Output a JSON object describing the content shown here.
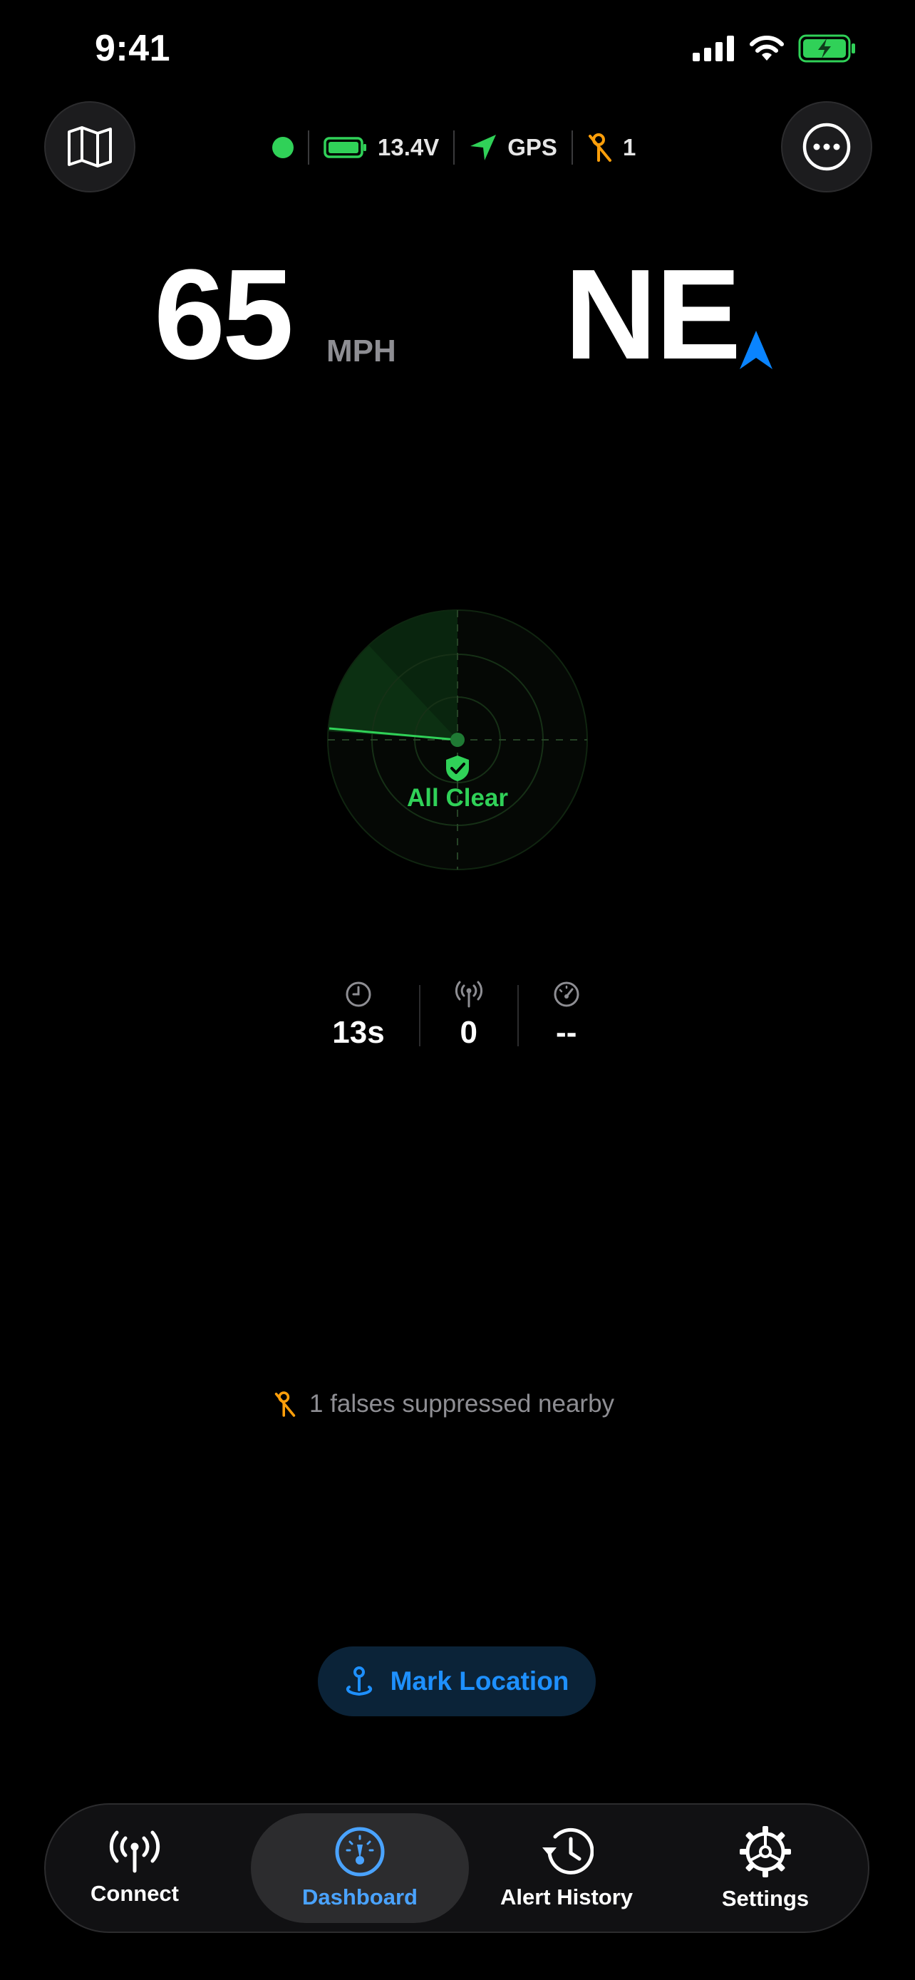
{
  "status_bar": {
    "time": "9:41"
  },
  "header": {
    "voltage": "13.4V",
    "gps_label": "GPS",
    "lockout_count": "1",
    "colors": {
      "connected": "#30d158",
      "lockout": "#ff9f0a"
    }
  },
  "speed": {
    "value": "65",
    "unit": "MPH"
  },
  "heading": {
    "value": "NE",
    "arrow_color": "#0a84ff"
  },
  "radar": {
    "status_label": "All Clear",
    "status_color": "#30d158"
  },
  "stats": [
    {
      "icon": "clock-icon",
      "value": "13s"
    },
    {
      "icon": "antenna-icon",
      "value": "0"
    },
    {
      "icon": "gauge-icon",
      "value": "--"
    }
  ],
  "suppressed": {
    "text": "1 falses suppressed nearby"
  },
  "mark_location": {
    "label": "Mark Location"
  },
  "tabs": [
    {
      "label": "Connect",
      "icon": "antenna-icon",
      "active": false
    },
    {
      "label": "Dashboard",
      "icon": "gauge-icon",
      "active": true
    },
    {
      "label": "Alert History",
      "icon": "history-icon",
      "active": false
    },
    {
      "label": "Settings",
      "icon": "gear-icon",
      "active": false
    }
  ]
}
